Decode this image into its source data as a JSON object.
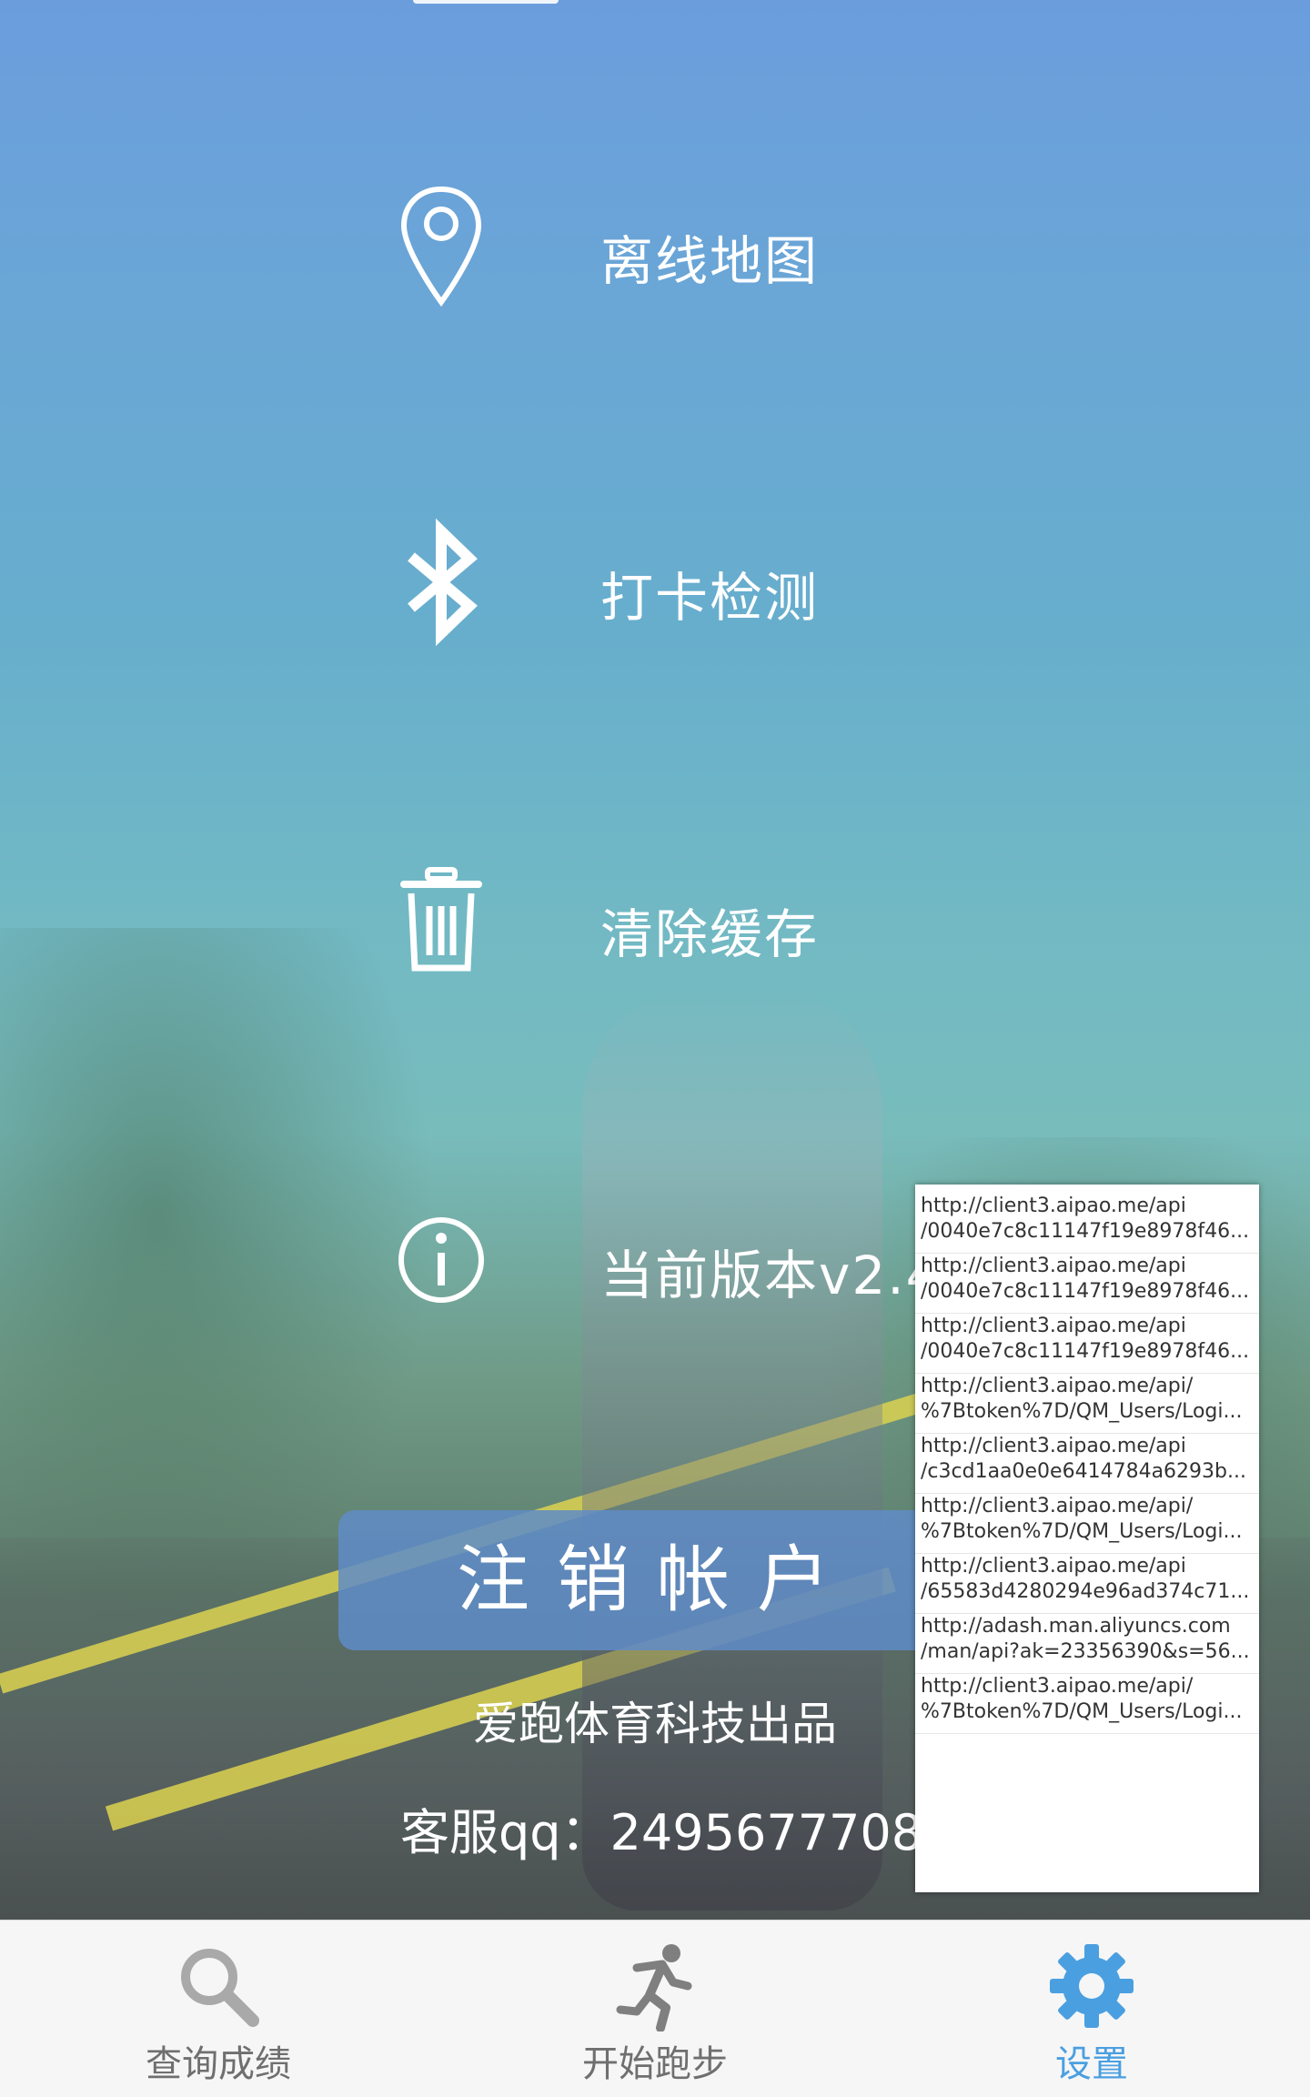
{
  "menu": {
    "items": [
      {
        "label": "离线地图",
        "icon": "map-pin-icon"
      },
      {
        "label": "打卡检测",
        "icon": "bluetooth-icon"
      },
      {
        "label": "清除缓存",
        "icon": "trash-icon"
      },
      {
        "label": "当前版本v2.4",
        "icon": "info-icon"
      }
    ]
  },
  "logout_button": "注销帐户",
  "footer": {
    "company": "爱跑体育科技出品",
    "service": "客服qq：2495677708"
  },
  "url_popup": {
    "items": [
      {
        "line1": "http://client3.aipao.me/api",
        "line2": "/0040e7c8c11147f19e8978f46..."
      },
      {
        "line1": "http://client3.aipao.me/api",
        "line2": "/0040e7c8c11147f19e8978f46..."
      },
      {
        "line1": "http://client3.aipao.me/api",
        "line2": "/0040e7c8c11147f19e8978f46..."
      },
      {
        "line1": "http://client3.aipao.me/api/",
        "line2": "%7Btoken%7D/QM_Users/Logi..."
      },
      {
        "line1": "http://client3.aipao.me/api",
        "line2": "/c3cd1aa0e0e6414784a6293b..."
      },
      {
        "line1": "http://client3.aipao.me/api/",
        "line2": "%7Btoken%7D/QM_Users/Logi..."
      },
      {
        "line1": "http://client3.aipao.me/api",
        "line2": "/65583d4280294e96ad374c71..."
      },
      {
        "line1": "http://adash.man.aliyuncs.com",
        "line2": "/man/api?ak=23356390&s=56..."
      },
      {
        "line1": "http://client3.aipao.me/api/",
        "line2": "%7Btoken%7D/QM_Users/Logi..."
      }
    ]
  },
  "tabbar": {
    "tabs": [
      {
        "label": "查询成绩",
        "icon": "search-icon"
      },
      {
        "label": "开始跑步",
        "icon": "runner-icon"
      },
      {
        "label": "设置",
        "icon": "gear-icon"
      }
    ],
    "active_index": 2,
    "active_color": "#4a9fe0",
    "inactive_color": "#6f6f6f"
  }
}
